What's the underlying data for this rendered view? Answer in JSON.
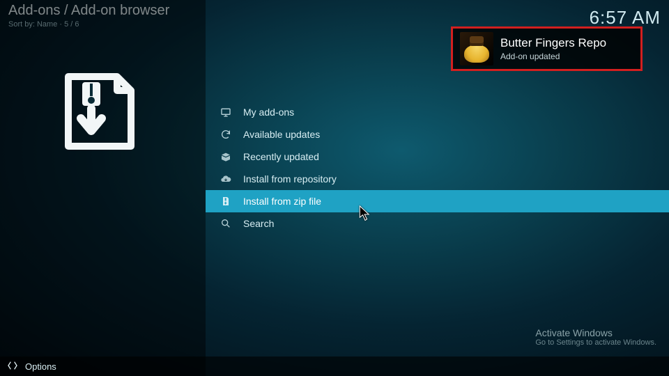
{
  "header": {
    "breadcrumb": "Add-ons / Add-on browser",
    "sort_prefix": "Sort by: ",
    "sort_value": "Name",
    "sort_sep": "  ·  ",
    "position": "5 / 6",
    "clock": "6:57 AM"
  },
  "menu": {
    "items": [
      {
        "label": "My add-ons",
        "icon": "tv-icon",
        "selected": false
      },
      {
        "label": "Available updates",
        "icon": "refresh-icon",
        "selected": false
      },
      {
        "label": "Recently updated",
        "icon": "box-open-icon",
        "selected": false
      },
      {
        "label": "Install from repository",
        "icon": "cloud-download-icon",
        "selected": false
      },
      {
        "label": "Install from zip file",
        "icon": "zip-file-icon",
        "selected": true
      },
      {
        "label": "Search",
        "icon": "search-icon",
        "selected": false
      }
    ]
  },
  "notification": {
    "title": "Butter Fingers Repo",
    "subtitle": "Add-on updated"
  },
  "watermark": {
    "line1": "Activate Windows",
    "line2": "Go to Settings to activate Windows."
  },
  "footer": {
    "options_label": "Options"
  }
}
